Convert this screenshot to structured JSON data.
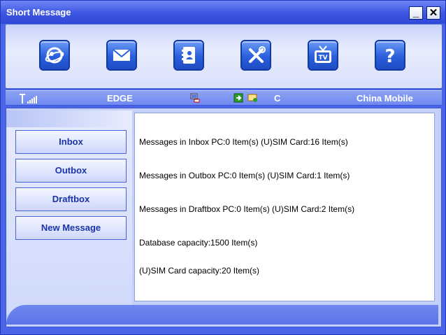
{
  "window": {
    "title": "Short Message"
  },
  "titlebar": {
    "minimize_glyph": "_",
    "close_glyph": "✕"
  },
  "toolbar": {
    "icons": [
      "internet-globe-icon",
      "envelope-icon",
      "address-book-icon",
      "tools-icon",
      "tv-icon",
      "help-icon"
    ],
    "tv_label": "TV",
    "help_label": "?"
  },
  "status": {
    "network_type": "EDGE",
    "connection_code": "C",
    "operator": "China Mobile"
  },
  "nav": {
    "inbox": "Inbox",
    "outbox": "Outbox",
    "draftbox": "Draftbox",
    "new_message": "New Message"
  },
  "summary": {
    "inbox": "Messages in Inbox PC:0 Item(s)  (U)SIM Card:16 Item(s)",
    "outbox": "Messages in Outbox PC:0 Item(s)  (U)SIM Card:1 Item(s)",
    "draftbox": "Messages in Draftbox PC:0 Item(s)  (U)SIM Card:2 Item(s)",
    "db_capacity": "Database capacity:1500 Item(s)",
    "sim_capacity": "(U)SIM Card capacity:20 Item(s)"
  },
  "colors": {
    "window_blue": "#4a64e8",
    "nav_text": "#1b33a8",
    "panel_light": "#e6ebfd"
  }
}
